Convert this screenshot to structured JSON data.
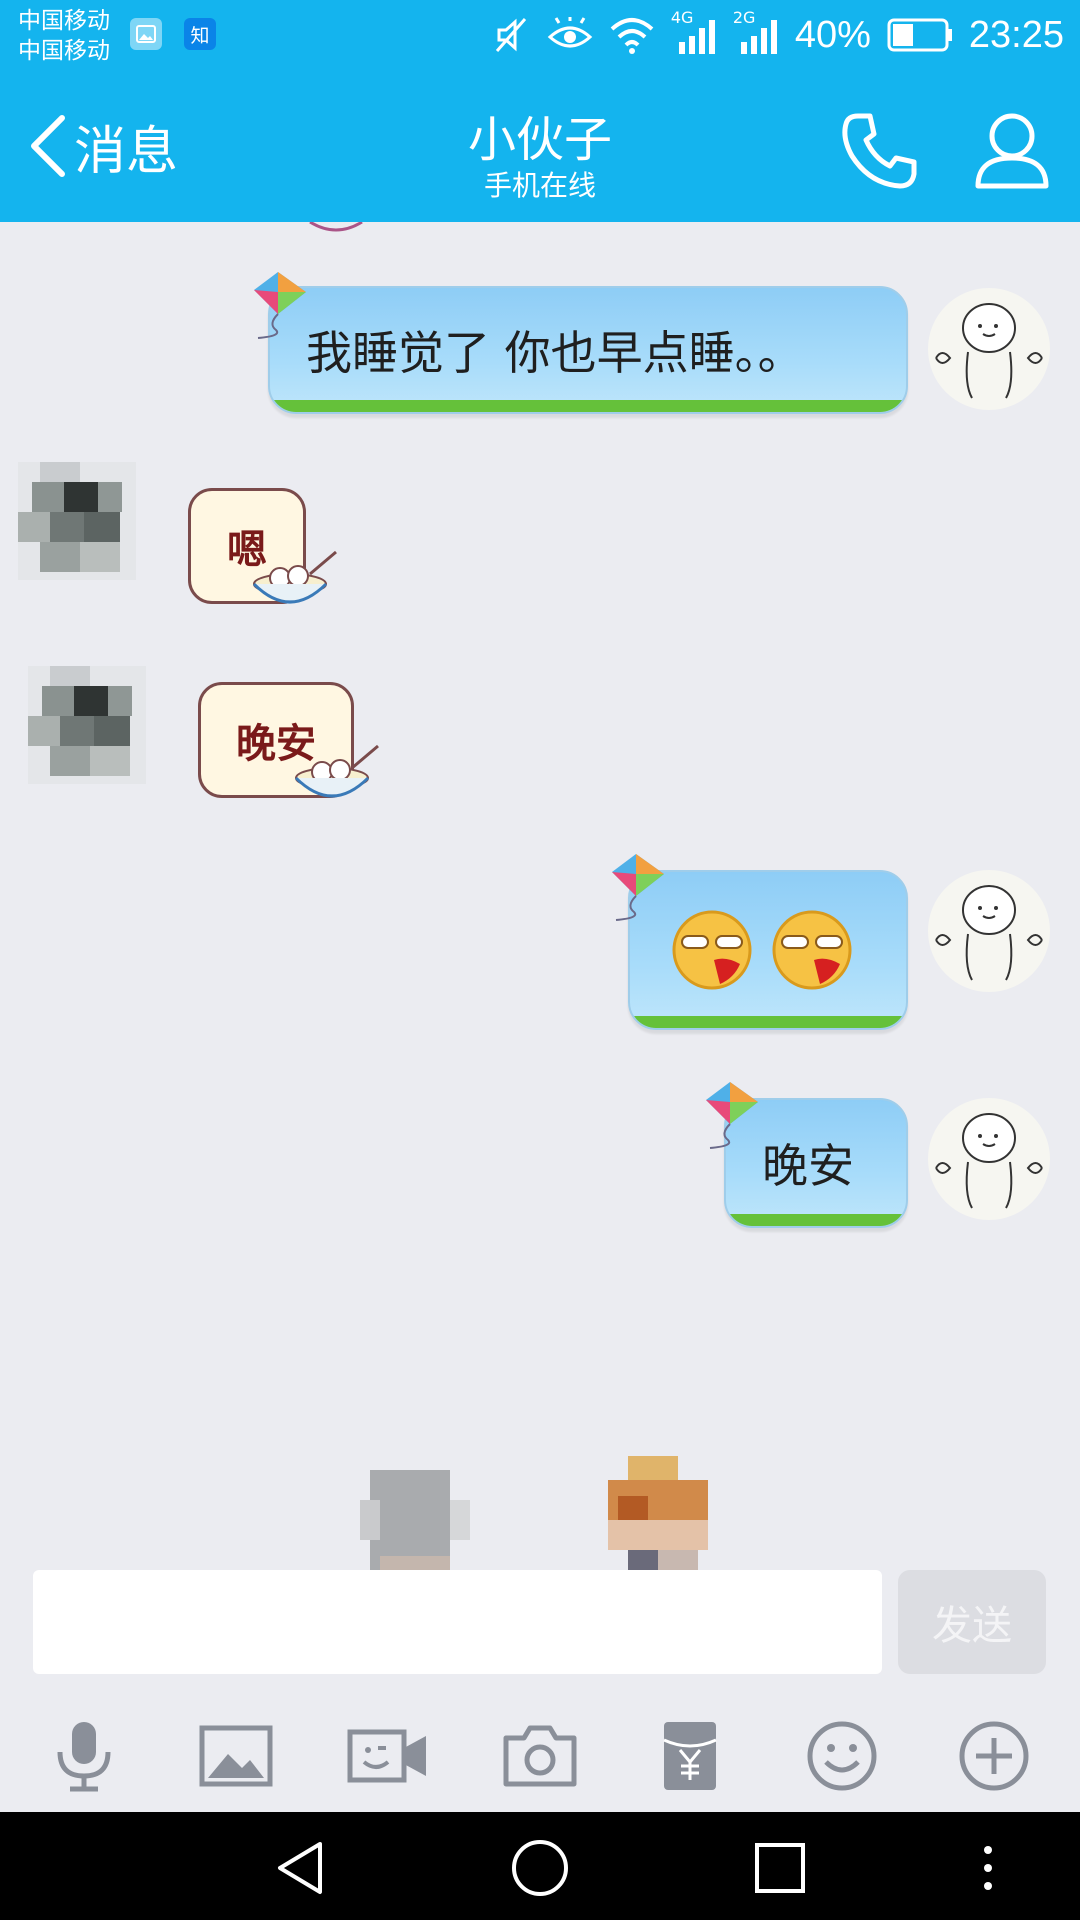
{
  "status_bar": {
    "carrier_1": "中国移动",
    "carrier_2": "中国移动",
    "gallery_icon": "image-icon",
    "zhihu_badge": "知",
    "network_1": "4G",
    "network_2": "2G",
    "battery_percent": "40%",
    "battery_level": 0.4,
    "time": "23:25"
  },
  "header": {
    "back_label": "消息",
    "contact_name": "小伙子",
    "contact_status": "手机在线",
    "call_icon": "phone-icon",
    "profile_icon": "person-icon"
  },
  "messages": [
    {
      "from": "self",
      "type": "text",
      "text": "我睡觉了 你也早点睡。。"
    },
    {
      "from": "peer",
      "type": "sticker",
      "text": "嗯"
    },
    {
      "from": "peer",
      "type": "sticker",
      "text": "晚安"
    },
    {
      "from": "self",
      "type": "emoji",
      "emojis": [
        "nosebleed-emoji",
        "nosebleed-emoji"
      ]
    },
    {
      "from": "self",
      "type": "text",
      "text": "晚安"
    }
  ],
  "composer": {
    "input_value": "",
    "send_label": "发送"
  },
  "toolbar": {
    "items": [
      "microphone-icon",
      "image-icon",
      "video-call-icon",
      "camera-icon",
      "red-packet-icon",
      "smiley-icon",
      "plus-icon"
    ]
  },
  "nav": {
    "items": [
      "back-triangle-icon",
      "home-circle-icon",
      "recents-square-icon",
      "more-dots-icon"
    ]
  },
  "colors": {
    "header_bg": "#14b4ee",
    "chat_bg": "#ebecf1",
    "bubble_self": "#a8dcfa",
    "icon_gray": "#8a8f99"
  }
}
